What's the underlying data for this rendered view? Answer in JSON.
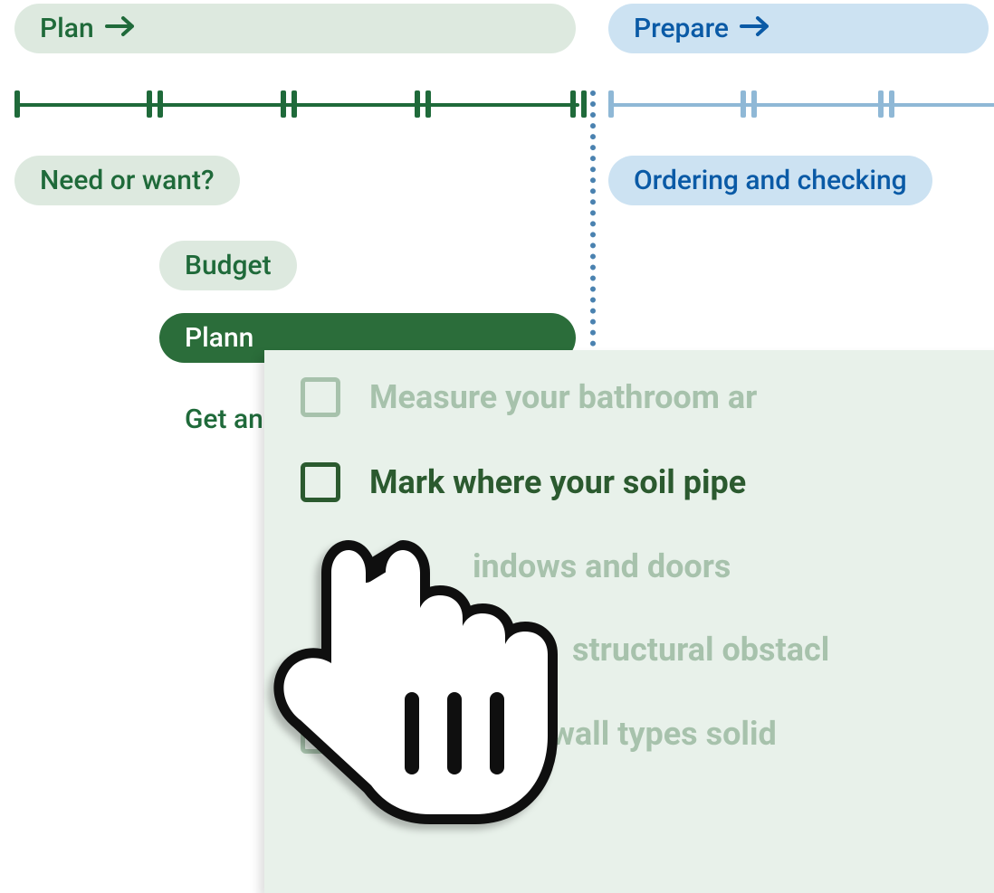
{
  "header": {
    "plan": {
      "label": "Plan"
    },
    "prepare": {
      "label": "Prepare"
    }
  },
  "tasks": {
    "need_or_want": "Need or want?",
    "budget": "Budget",
    "planning": "Plann",
    "get_an": "Get an",
    "ordering": "Ordering and checking"
  },
  "checklist": {
    "items": [
      {
        "label": "Measure your bathroom ar",
        "active": false
      },
      {
        "label": "Mark where your soil pipe",
        "active": true
      },
      {
        "label": "indows and doors",
        "active": false
      },
      {
        "label": "structural obstacl",
        "active": false
      },
      {
        "label": "your wall types solid",
        "active": false
      }
    ]
  },
  "colors": {
    "greenDark": "#2b6d3a",
    "greenLight": "#dde9df",
    "greenText": "#1f6a3a",
    "blueLight": "#cce2f2",
    "blueText": "#0a5aa6",
    "panelBg": "#e8f1ea",
    "faded": "#a7c2ac"
  }
}
